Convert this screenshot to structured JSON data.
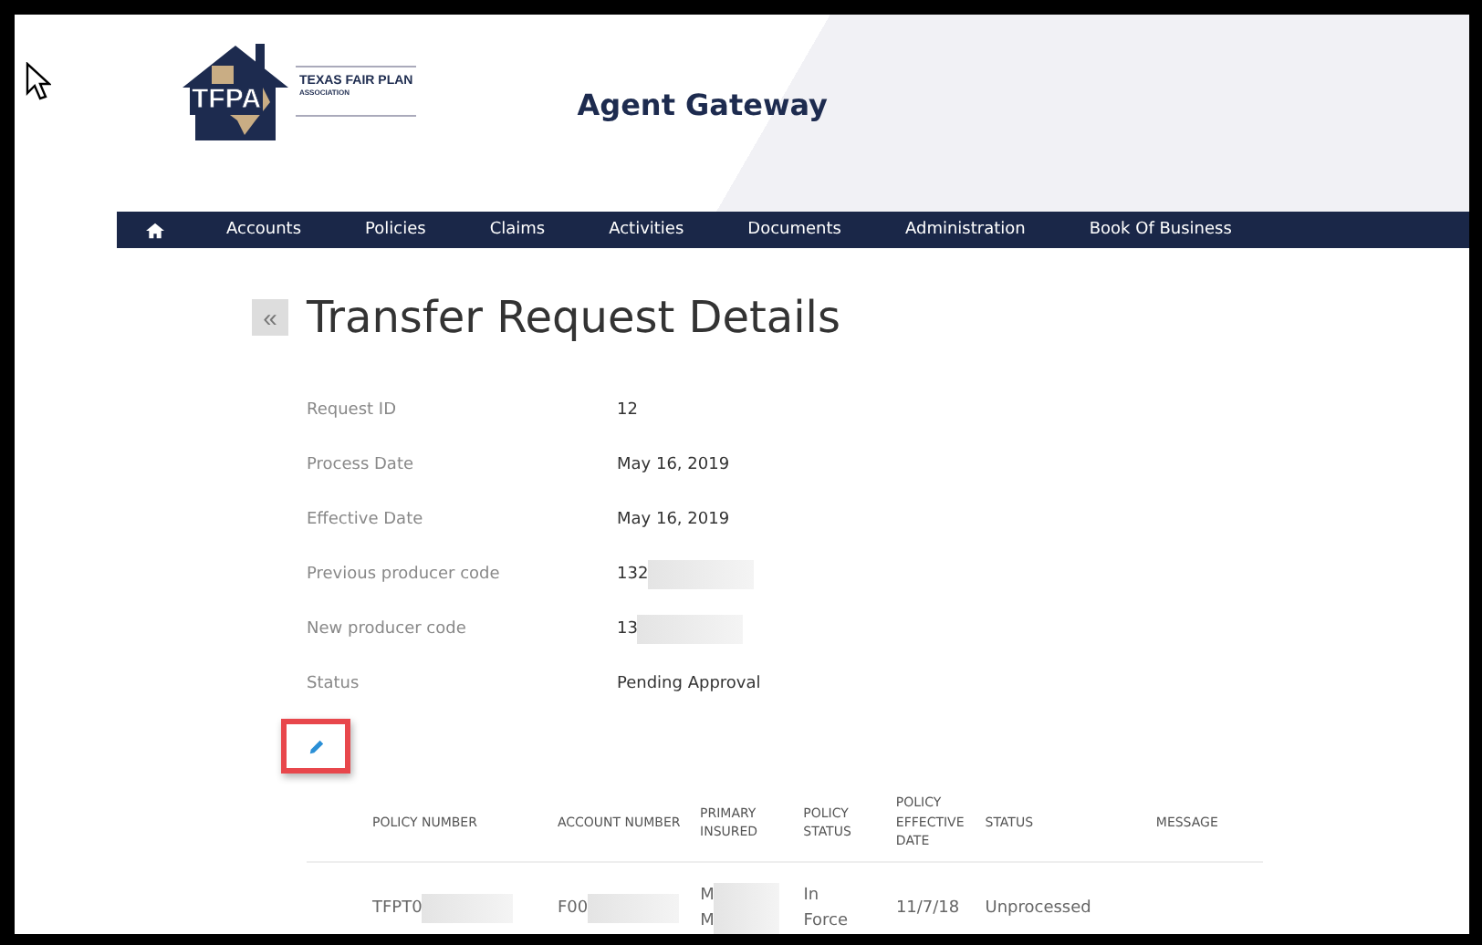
{
  "logo": {
    "mark": "TFPA",
    "name": "TEXAS FAIR PLAN",
    "subname": "ASSOCIATION"
  },
  "header": {
    "title": "Agent Gateway"
  },
  "nav": {
    "items": [
      "Accounts",
      "Policies",
      "Claims",
      "Activities",
      "Documents",
      "Administration",
      "Book Of Business"
    ]
  },
  "page": {
    "back": "«",
    "title": "Transfer Request Details"
  },
  "details": [
    {
      "label": "Request ID",
      "value": "12",
      "redacted": false
    },
    {
      "label": "Process Date",
      "value": "May 16, 2019",
      "redacted": false
    },
    {
      "label": "Effective Date",
      "value": "May 16, 2019",
      "redacted": false
    },
    {
      "label": "Previous producer code",
      "value": "132",
      "redacted": true
    },
    {
      "label": "New producer code",
      "value": "13",
      "redacted": true
    },
    {
      "label": "Status",
      "value": "Pending Approval",
      "redacted": false
    }
  ],
  "table": {
    "columns": [
      "POLICY NUMBER",
      "ACCOUNT NUMBER",
      "PRIMARY INSURED",
      "POLICY STATUS",
      "POLICY EFFECTIVE DATE",
      "STATUS",
      "MESSAGE"
    ],
    "rows": [
      {
        "cells": [
          {
            "lines": [
              "TFPT0"
            ],
            "redacted": true
          },
          {
            "lines": [
              "F00"
            ],
            "redacted": true
          },
          {
            "lines": [
              "M",
              "M"
            ],
            "redacted": true
          },
          {
            "lines": [
              "In",
              "Force"
            ],
            "redacted": false
          },
          {
            "lines": [
              "11/7/18"
            ],
            "redacted": false
          },
          {
            "lines": [
              "Unprocessed"
            ],
            "redacted": false
          },
          {
            "redacted": false
          }
        ]
      }
    ]
  }
}
